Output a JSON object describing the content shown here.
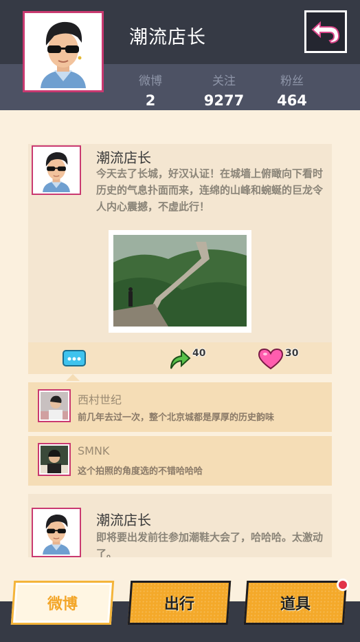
{
  "header": {
    "user_name": "潮流店长",
    "stats": [
      {
        "label": "微博",
        "value": "2"
      },
      {
        "label": "关注",
        "value": "9277"
      },
      {
        "label": "粉丝",
        "value": "464"
      }
    ]
  },
  "posts": [
    {
      "author": "潮流店长",
      "text": "今天去了长城，好汉认证！在城墙上俯瞰向下看时历史的气息扑面而来，连绵的山峰和蜿蜒的巨龙令人内心震撼，不虚此行！",
      "actions": {
        "comment_icon": "comment-bubble-icon",
        "forward_count": "40",
        "like_count": "30"
      },
      "comments": [
        {
          "name": "西村世纪",
          "text": "前几年去过一次，整个北京城都是厚厚的历史韵味"
        },
        {
          "name": "SMNK",
          "text": "这个拍照的角度选的不错哈哈哈"
        }
      ]
    },
    {
      "author": "潮流店长",
      "text": "即将要出发前往参加潮鞋大会了，哈哈哈。太激动了。"
    }
  ],
  "nav": {
    "tabs": [
      {
        "label": "微博",
        "active": true
      },
      {
        "label": "出行",
        "active": false
      },
      {
        "label": "道具",
        "active": false,
        "has_notification": true
      }
    ]
  },
  "colors": {
    "header_bg": "#363a45",
    "accent_pink": "#c93970",
    "nav_orange": "#f4a92a",
    "page_bg": "#fbf0de"
  }
}
